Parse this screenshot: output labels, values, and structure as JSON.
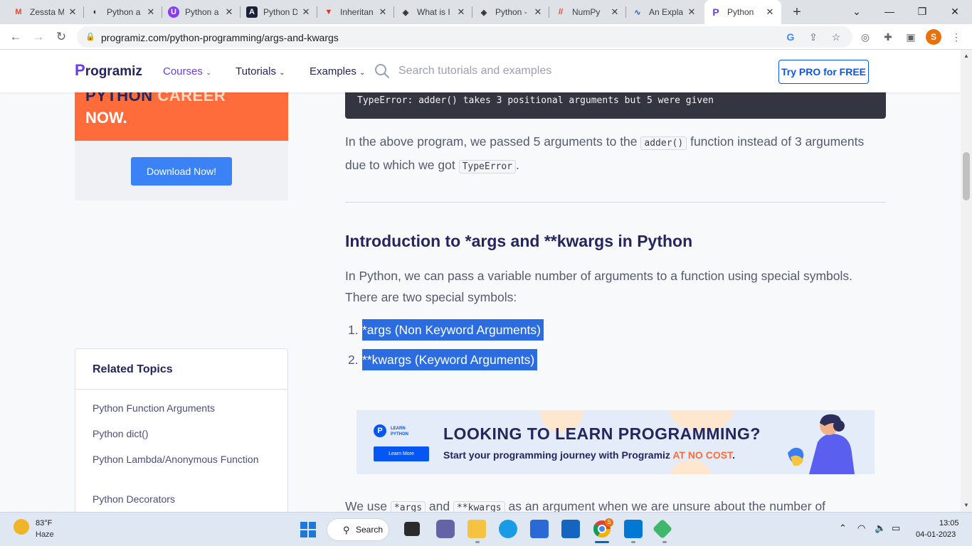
{
  "browser": {
    "tabs": [
      {
        "title": "Zessta M",
        "icon_color": "#ea4335",
        "icon_letter": "M"
      },
      {
        "title": "Python a",
        "icon_color": "#24292f",
        "icon_letter": "◐"
      },
      {
        "title": "Python a",
        "icon_color": "#8a3cf5",
        "icon_letter": "U"
      },
      {
        "title": "Python D",
        "icon_color": "#1b2238",
        "icon_letter": "A"
      },
      {
        "title": "Inheritan",
        "icon_color": "#e8302a",
        "icon_letter": "▼"
      },
      {
        "title": "What is I",
        "icon_color": "#2f2f2f",
        "icon_letter": "◈"
      },
      {
        "title": "Python -",
        "icon_color": "#2f2f2f",
        "icon_letter": "◈"
      },
      {
        "title": "NumPy",
        "icon_color": "#e8452b",
        "icon_letter": "//"
      },
      {
        "title": "An Expla",
        "icon_color": "#2264b8",
        "icon_letter": "∿"
      },
      {
        "title": "Python",
        "icon_color": "#6a3cf0",
        "icon_letter": "P"
      }
    ],
    "active_tab_index": 9,
    "url": "programiz.com/python-programming/args-and-kwargs",
    "profile_letter": "S"
  },
  "site": {
    "logo_text": "rogramiz",
    "logo_p": "P",
    "nav": {
      "courses": "Courses",
      "tutorials": "Tutorials",
      "examples": "Examples"
    },
    "search_placeholder": "Search tutorials and examples",
    "pro_button": "Try PRO for FREE"
  },
  "sidebar": {
    "promo_line1_dark": "PYTHON",
    "promo_line1_light": "CAREER",
    "promo_line2": "NOW.",
    "download_button": "Download Now!",
    "related_title": "Related Topics",
    "related_links": [
      "Python Function Arguments",
      "Python dict()",
      "Python Lambda/Anonymous Function",
      "Python Decorators"
    ]
  },
  "article": {
    "code_output": "TypeError: adder() takes 3 positional arguments but 5 were given",
    "p1_a": "In the above program, we passed 5 arguments to the",
    "p1_code1": "adder()",
    "p1_b": "function instead of 3 arguments due to which we got",
    "p1_code2": "TypeError",
    "p1_c": ".",
    "heading": "Introduction to *args and **kwargs in Python",
    "p2": "In Python, we can pass a variable number of arguments to a function using special symbols. There are two special symbols:",
    "list": [
      {
        "num": "1.",
        "text": "*args (Non Keyword Arguments)"
      },
      {
        "num": "2.",
        "text": "**kwargs (Keyword Arguments)"
      }
    ],
    "p3_a": "We use",
    "p3_code1": "*args",
    "p3_b": "and",
    "p3_code2": "**kwargs",
    "p3_c": "as an argument when we are unsure about the number of"
  },
  "banner": {
    "learn_label": "LEARN PYTHON",
    "learn_more": "Learn More",
    "headline": "LOOKING TO LEARN PROGRAMMING?",
    "sub_a": "Start your programming journey with Programiz",
    "sub_b": "AT NO COST",
    "sub_c": "."
  },
  "taskbar": {
    "temperature": "83°F",
    "weather": "Haze",
    "search_label": "Search",
    "time": "13:05",
    "date": "04-01-2023"
  },
  "colors": {
    "accent": "#6a3cf0",
    "promo": "#ff6c3b",
    "selection": "#2b6de0",
    "pro_blue": "#0556f3"
  }
}
